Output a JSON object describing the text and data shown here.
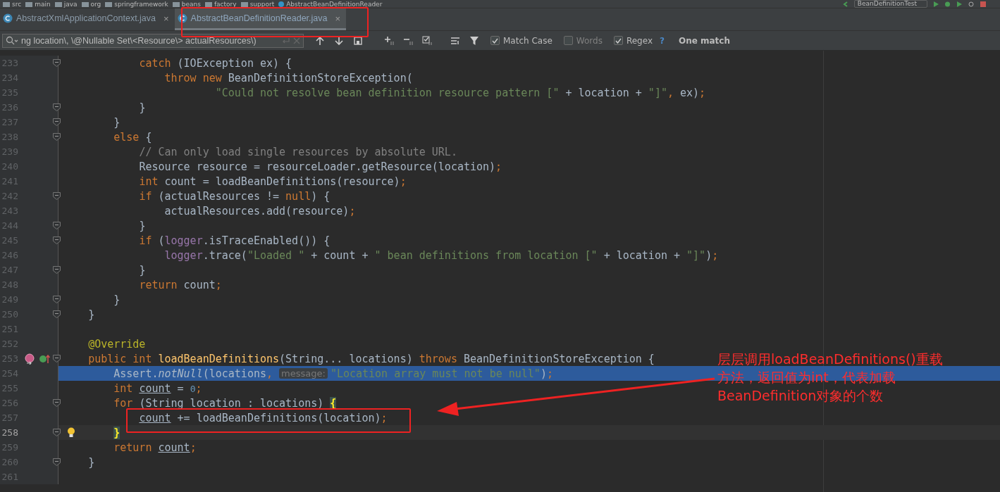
{
  "breadcrumbs": [
    "src",
    "main",
    "java",
    "org",
    "springframework",
    "beans",
    "factory",
    "support",
    "AbstractBeanDefinitionReader"
  ],
  "run_config": "BeanDefinitionTest",
  "tabs": [
    {
      "label": "AbstractXmlApplicationContext.java",
      "close": "×",
      "selected": false
    },
    {
      "label": "AbstractBeanDefinitionReader.java",
      "close": "×",
      "selected": true
    }
  ],
  "find_bar": {
    "value": "ng location\\, \\@Nullable Set\\<Resource\\> actualResources\\)",
    "options": [
      {
        "label": "Match Case",
        "checked": true
      },
      {
        "label": "Words",
        "checked": false
      },
      {
        "label": "Regex",
        "checked": true
      }
    ],
    "help": "?",
    "result": "One match"
  },
  "code_lines": [
    {
      "n": "233",
      "fold": true,
      "highlighted": false,
      "caret": false,
      "breakpoint": false,
      "override": false,
      "bulb": false,
      "tokens": [
        {
          "kind": "kw",
          "text": "            catch "
        },
        {
          "kind": "p",
          "text": "(IOException ex) {"
        }
      ]
    },
    {
      "n": "234",
      "fold": false,
      "highlighted": false,
      "caret": false,
      "breakpoint": false,
      "override": false,
      "bulb": false,
      "tokens": [
        {
          "kind": "kw",
          "text": "                throw new "
        },
        {
          "kind": "p",
          "text": "BeanDefinitionStoreException("
        }
      ]
    },
    {
      "n": "235",
      "fold": false,
      "highlighted": false,
      "caret": false,
      "breakpoint": false,
      "override": false,
      "bulb": false,
      "tokens": [
        {
          "kind": "str",
          "text": "                        \"Could not resolve bean definition resource pattern [\""
        },
        {
          "kind": "p",
          "text": " + location + "
        },
        {
          "kind": "str",
          "text": "\"]\""
        },
        {
          "kind": "kw",
          "text": ", "
        },
        {
          "kind": "p",
          "text": "ex)"
        },
        {
          "kind": "kw",
          "text": ";"
        }
      ]
    },
    {
      "n": "236",
      "fold": true,
      "highlighted": false,
      "caret": false,
      "breakpoint": false,
      "override": false,
      "bulb": false,
      "tokens": [
        {
          "kind": "p",
          "text": "            }"
        }
      ]
    },
    {
      "n": "237",
      "fold": true,
      "highlighted": false,
      "caret": false,
      "breakpoint": false,
      "override": false,
      "bulb": false,
      "tokens": [
        {
          "kind": "p",
          "text": "        }"
        }
      ]
    },
    {
      "n": "238",
      "fold": true,
      "highlighted": false,
      "caret": false,
      "breakpoint": false,
      "override": false,
      "bulb": false,
      "tokens": [
        {
          "kind": "kw",
          "text": "        else "
        },
        {
          "kind": "p",
          "text": "{"
        }
      ]
    },
    {
      "n": "239",
      "fold": false,
      "highlighted": false,
      "caret": false,
      "breakpoint": false,
      "override": false,
      "bulb": false,
      "tokens": [
        {
          "kind": "cm",
          "text": "            // Can only load single resources by absolute URL."
        }
      ]
    },
    {
      "n": "240",
      "fold": false,
      "highlighted": false,
      "caret": false,
      "breakpoint": false,
      "override": false,
      "bulb": false,
      "tokens": [
        {
          "kind": "p",
          "text": "            Resource resource = resourceLoader.getResource(location)"
        },
        {
          "kind": "kw",
          "text": ";"
        }
      ]
    },
    {
      "n": "241",
      "fold": false,
      "highlighted": false,
      "caret": false,
      "breakpoint": false,
      "override": false,
      "bulb": false,
      "tokens": [
        {
          "kind": "kw",
          "text": "            int "
        },
        {
          "kind": "p",
          "text": "count = loadBeanDefinitions(resource)"
        },
        {
          "kind": "kw",
          "text": ";"
        }
      ]
    },
    {
      "n": "242",
      "fold": true,
      "highlighted": false,
      "caret": false,
      "breakpoint": false,
      "override": false,
      "bulb": false,
      "tokens": [
        {
          "kind": "kw",
          "text": "            if "
        },
        {
          "kind": "p",
          "text": "(actualResources != "
        },
        {
          "kind": "kw",
          "text": "null"
        },
        {
          "kind": "p",
          "text": ") {"
        }
      ]
    },
    {
      "n": "243",
      "fold": false,
      "highlighted": false,
      "caret": false,
      "breakpoint": false,
      "override": false,
      "bulb": false,
      "tokens": [
        {
          "kind": "p",
          "text": "                actualResources.add(resource)"
        },
        {
          "kind": "kw",
          "text": ";"
        }
      ]
    },
    {
      "n": "244",
      "fold": true,
      "highlighted": false,
      "caret": false,
      "breakpoint": false,
      "override": false,
      "bulb": false,
      "tokens": [
        {
          "kind": "p",
          "text": "            }"
        }
      ]
    },
    {
      "n": "245",
      "fold": true,
      "highlighted": false,
      "caret": false,
      "breakpoint": false,
      "override": false,
      "bulb": false,
      "tokens": [
        {
          "kind": "kw",
          "text": "            if "
        },
        {
          "kind": "p",
          "text": "("
        },
        {
          "kind": "fld",
          "text": "logger"
        },
        {
          "kind": "p",
          "text": ".isTraceEnabled()) {"
        }
      ]
    },
    {
      "n": "246",
      "fold": false,
      "highlighted": false,
      "caret": false,
      "breakpoint": false,
      "override": false,
      "bulb": false,
      "tokens": [
        {
          "kind": "fld",
          "text": "                logger"
        },
        {
          "kind": "p",
          "text": ".trace("
        },
        {
          "kind": "str",
          "text": "\"Loaded \""
        },
        {
          "kind": "p",
          "text": " + count + "
        },
        {
          "kind": "str",
          "text": "\" bean definitions from location [\""
        },
        {
          "kind": "p",
          "text": " + location + "
        },
        {
          "kind": "str",
          "text": "\"]\""
        },
        {
          "kind": "p",
          "text": ")"
        },
        {
          "kind": "kw",
          "text": ";"
        }
      ]
    },
    {
      "n": "247",
      "fold": true,
      "highlighted": false,
      "caret": false,
      "breakpoint": false,
      "override": false,
      "bulb": false,
      "tokens": [
        {
          "kind": "p",
          "text": "            }"
        }
      ]
    },
    {
      "n": "248",
      "fold": false,
      "highlighted": false,
      "caret": false,
      "breakpoint": false,
      "override": false,
      "bulb": false,
      "tokens": [
        {
          "kind": "kw",
          "text": "            return "
        },
        {
          "kind": "p",
          "text": "count"
        },
        {
          "kind": "kw",
          "text": ";"
        }
      ]
    },
    {
      "n": "249",
      "fold": true,
      "highlighted": false,
      "caret": false,
      "breakpoint": false,
      "override": false,
      "bulb": false,
      "tokens": [
        {
          "kind": "p",
          "text": "        }"
        }
      ]
    },
    {
      "n": "250",
      "fold": true,
      "highlighted": false,
      "caret": false,
      "breakpoint": false,
      "override": false,
      "bulb": false,
      "tokens": [
        {
          "kind": "p",
          "text": "    }"
        }
      ]
    },
    {
      "n": "251",
      "fold": false,
      "highlighted": false,
      "caret": false,
      "breakpoint": false,
      "override": false,
      "bulb": false
    },
    {
      "n": "252",
      "fold": false,
      "highlighted": false,
      "caret": false,
      "breakpoint": false,
      "override": false,
      "bulb": false,
      "tokens": [
        {
          "kind": "ann",
          "text": "    @Override"
        }
      ]
    },
    {
      "n": "253",
      "fold": true,
      "highlighted": false,
      "caret": false,
      "breakpoint": true,
      "override": true,
      "bulb": false,
      "tokens": [
        {
          "kind": "kw",
          "text": "    public int "
        },
        {
          "kind": "decl",
          "text": "loadBeanDefinitions"
        },
        {
          "kind": "p",
          "text": "(String... locations) "
        },
        {
          "kind": "kw",
          "text": "throws "
        },
        {
          "kind": "p",
          "text": "BeanDefinitionStoreException {"
        }
      ]
    },
    {
      "n": "254",
      "fold": false,
      "highlighted": true,
      "caret": false,
      "breakpoint": false,
      "override": false,
      "bulb": false,
      "tokens": [
        {
          "kind": "p",
          "text": "        Assert."
        },
        {
          "kind": "it",
          "text": "notNull"
        },
        {
          "kind": "p",
          "text": "(locations"
        },
        {
          "kind": "kw",
          "text": ", "
        },
        {
          "kind": "hint",
          "text": "message:"
        },
        {
          "kind": "str",
          "text": "\"Location array must not be null\""
        },
        {
          "kind": "p",
          "text": ")"
        },
        {
          "kind": "kw",
          "text": ";"
        }
      ]
    },
    {
      "n": "255",
      "fold": false,
      "highlighted": false,
      "caret": false,
      "breakpoint": false,
      "override": false,
      "bulb": false,
      "tokens": [
        {
          "kind": "kw",
          "text": "        int "
        },
        {
          "kind": "u",
          "text": "count"
        },
        {
          "kind": "p",
          "text": " = "
        },
        {
          "kind": "num",
          "text": "0"
        },
        {
          "kind": "kw",
          "text": ";"
        }
      ]
    },
    {
      "n": "256",
      "fold": true,
      "highlighted": false,
      "caret": false,
      "breakpoint": false,
      "override": false,
      "bulb": false,
      "tokens": [
        {
          "kind": "kw",
          "text": "        for "
        },
        {
          "kind": "p",
          "text": "(String location : locations) "
        },
        {
          "kind": "bm",
          "text": "{"
        }
      ]
    },
    {
      "n": "257",
      "fold": false,
      "highlighted": false,
      "caret": false,
      "breakpoint": false,
      "override": false,
      "bulb": false,
      "tokens": [
        {
          "kind": "u",
          "text": "            count"
        },
        {
          "kind": "p",
          "text": " += loadBeanDefinitions(location)"
        },
        {
          "kind": "kw",
          "text": ";"
        }
      ]
    },
    {
      "n": "258",
      "fold": true,
      "highlighted": false,
      "caret": true,
      "breakpoint": false,
      "override": false,
      "bulb": true,
      "tokens": [
        {
          "kind": "bm",
          "text": "        }"
        }
      ]
    },
    {
      "n": "259",
      "fold": false,
      "highlighted": false,
      "caret": false,
      "breakpoint": false,
      "override": false,
      "bulb": false,
      "tokens": [
        {
          "kind": "kw",
          "text": "        return "
        },
        {
          "kind": "u",
          "text": "count"
        },
        {
          "kind": "kw",
          "text": ";"
        }
      ]
    },
    {
      "n": "260",
      "fold": true,
      "highlighted": false,
      "caret": false,
      "breakpoint": false,
      "override": false,
      "bulb": false,
      "tokens": [
        {
          "kind": "p",
          "text": "    }"
        }
      ]
    },
    {
      "n": "261",
      "fold": false,
      "highlighted": false,
      "caret": false,
      "breakpoint": false,
      "override": false,
      "bulb": false
    }
  ],
  "note": {
    "lines": [
      "层层调用loadBeanDefinitions()重载",
      "方法，返回值为int，代表加载",
      "BeanDefinition对象的个数"
    ]
  }
}
